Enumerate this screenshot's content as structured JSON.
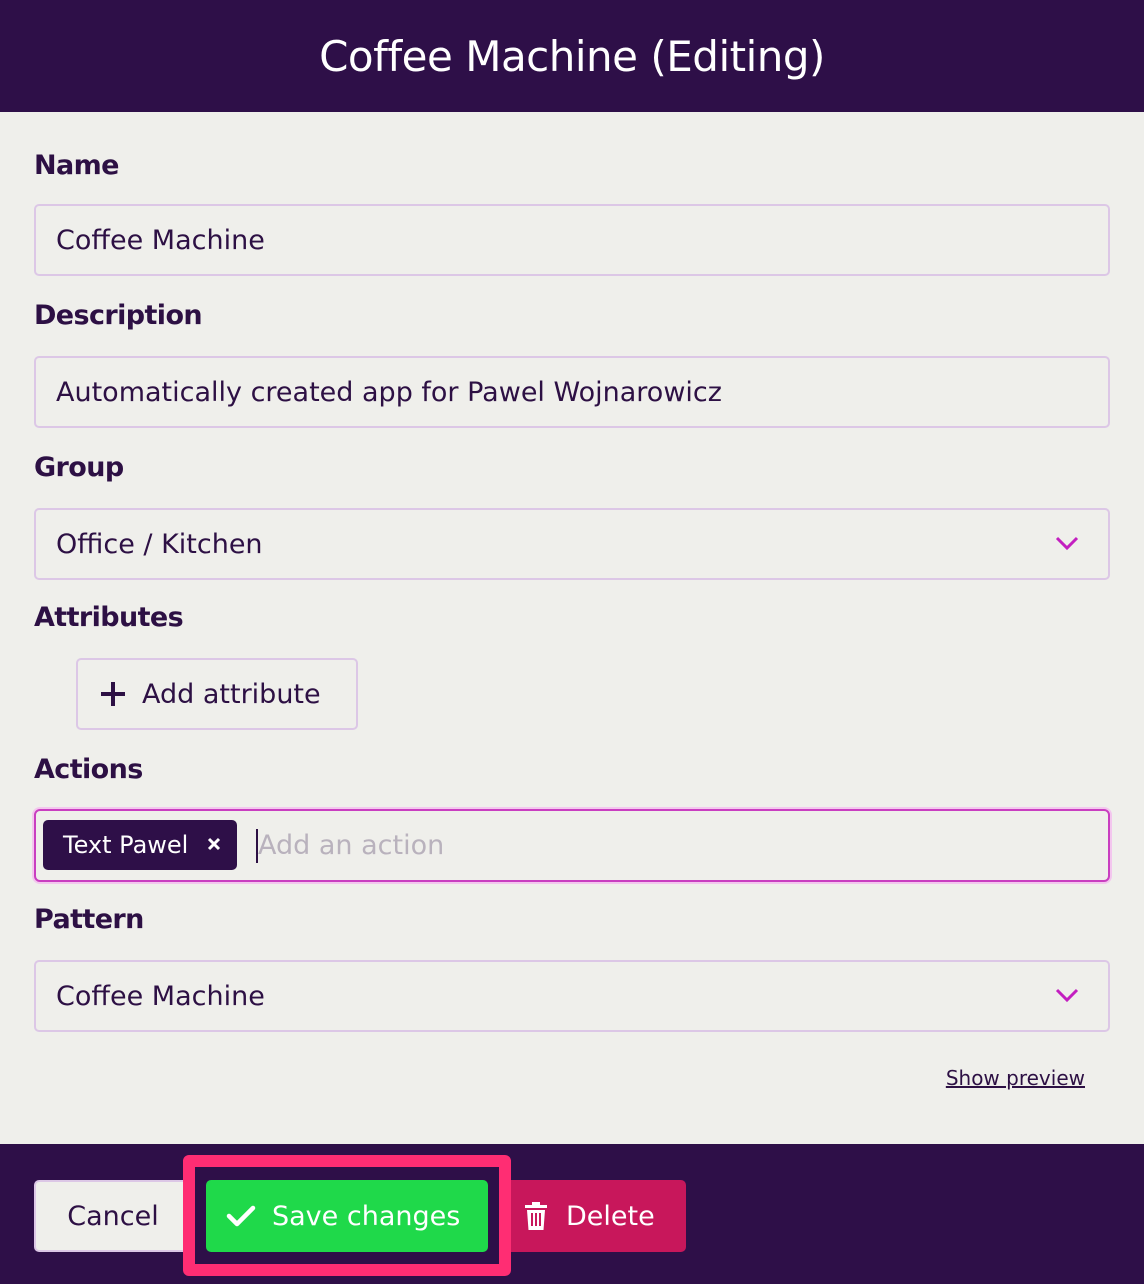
{
  "header": {
    "title": "Coffee Machine (Editing)"
  },
  "form": {
    "name_label": "Name",
    "name_value": "Coffee Machine",
    "description_label": "Description",
    "description_value": "Automatically created app for Pawel Wojnarowicz",
    "group_label": "Group",
    "group_value": "Office / Kitchen",
    "attributes_label": "Attributes",
    "add_attribute_label": "Add attribute",
    "actions_label": "Actions",
    "actions_tags": [
      "Text Pawel"
    ],
    "actions_placeholder": "Add an action",
    "pattern_label": "Pattern",
    "pattern_value": "Coffee Machine",
    "show_preview_label": "Show preview"
  },
  "footer": {
    "cancel_label": "Cancel",
    "save_label": "Save changes",
    "delete_label": "Delete"
  },
  "colors": {
    "header_bg": "#2e0f48",
    "save_bg": "#1fd94a",
    "delete_bg": "#c8175b",
    "highlight": "#ff2d73"
  }
}
